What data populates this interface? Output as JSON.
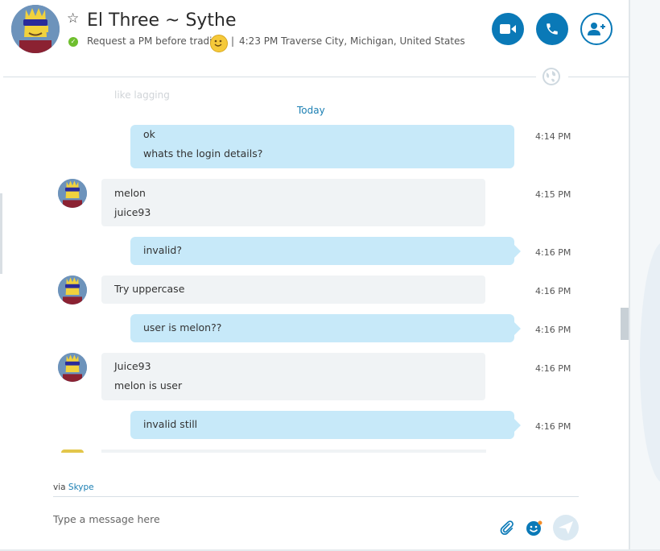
{
  "header": {
    "title": "El Three ~ Sythe",
    "mood": "Request a PM before trading",
    "separator": "|",
    "location": "4:23 PM Traverse City, Michigan, United States"
  },
  "conversation": {
    "faded_text": "like lagging",
    "date_divider": "Today",
    "messages": [
      {
        "dir": "out",
        "lines": [
          "ok",
          "whats the login details?"
        ],
        "time": "4:14 PM"
      },
      {
        "dir": "in",
        "lines": [
          "melon",
          "juice93"
        ],
        "time": "4:15 PM"
      },
      {
        "dir": "out",
        "lines": [
          "invalid?"
        ],
        "time": "4:16 PM"
      },
      {
        "dir": "in",
        "lines": [
          "Try uppercase"
        ],
        "time": "4:16 PM"
      },
      {
        "dir": "out",
        "lines": [
          "user is melon??"
        ],
        "time": "4:16 PM"
      },
      {
        "dir": "in",
        "lines": [
          "Juice93",
          "melon is user"
        ],
        "time": "4:16 PM"
      },
      {
        "dir": "out",
        "lines": [
          "invalid still"
        ],
        "time": "4:16 PM"
      }
    ]
  },
  "footer": {
    "via_prefix": "via",
    "via_link": "Skype",
    "compose_placeholder": "Type a message here"
  },
  "colors": {
    "accent": "#0a79b7",
    "outgoing_bubble": "#c7e9f9",
    "incoming_bubble": "#f0f3f5",
    "online": "#6fbf2e"
  },
  "icons": {
    "video": "video-camera-icon",
    "call": "phone-icon",
    "add": "add-person-icon",
    "star": "star-icon",
    "attach": "paperclip-icon",
    "emoji": "emoticon-icon",
    "send": "send-icon",
    "globe": "globe-icon"
  }
}
